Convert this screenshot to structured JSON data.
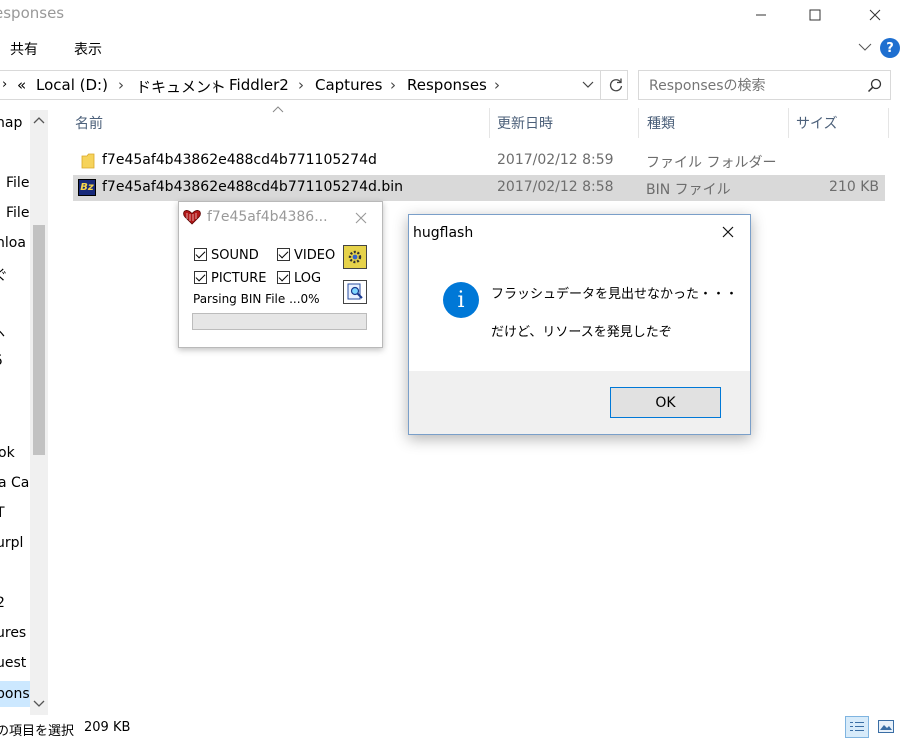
{
  "explorer": {
    "title": "esponses",
    "ribbon": {
      "tabs": [
        "共有",
        "表示"
      ]
    },
    "address": {
      "overflow": "«",
      "crumbs": [
        "Local (D:)",
        "ドキュメント",
        "Fiddler2",
        "Captures",
        "Responses"
      ]
    },
    "search": {
      "placeholder": "Responsesの検索"
    },
    "columns": {
      "name": "名前",
      "date": "更新日時",
      "type": "種類",
      "size": "サイズ"
    },
    "files": [
      {
        "name": "f7e45af4b43862e488cd4b771105274d",
        "date": "2017/02/12 8:59",
        "type": "ファイル フォルダー",
        "size": "",
        "icon": "folder-icon"
      },
      {
        "name": "f7e45af4b43862e488cd4b771105274d.bin",
        "date": "2017/02/12 8:58",
        "type": "BIN ファイル",
        "size": "210 KB",
        "icon": "bz-file-icon"
      }
    ],
    "sidebar": [
      "nap",
      "File",
      "File",
      "nloa",
      "ぐ",
      "ř",
      "ヽ",
      "5",
      "ok",
      "a Ca",
      "T",
      "urpl",
      "2",
      "ures",
      "uest",
      "pons"
    ],
    "status": {
      "selection": "の項目を選択",
      "size": "209 KB"
    }
  },
  "hugflash_window": {
    "title": "f7e45af4b4386...",
    "options": {
      "sound": "SOUND",
      "video": "VIDEO",
      "picture": "PICTURE",
      "log": "LOG"
    },
    "status": "Parsing BIN File ...0%",
    "progress": 0
  },
  "dialog": {
    "title": "hugflash",
    "line1": "フラッシュデータを見出せなかった・・・",
    "line2": "だけど、リソースを発見したぞ",
    "ok": "OK",
    "accent": "#0078d7"
  }
}
